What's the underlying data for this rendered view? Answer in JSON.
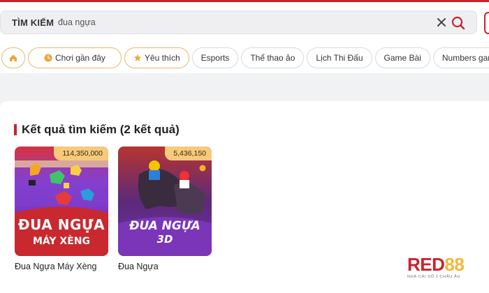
{
  "search": {
    "label": "TÌM KIẾM",
    "value": "đua ngựa"
  },
  "tabs": [
    {
      "label": "",
      "icon": "home-icon"
    },
    {
      "label": "Chơi gần đây",
      "icon": "clock-icon"
    },
    {
      "label": "Yêu thích",
      "icon": "star-icon"
    },
    {
      "label": "Esports"
    },
    {
      "label": "Thể thao ảo"
    },
    {
      "label": "Lịch Thi Đấu"
    },
    {
      "label": "Game Bài"
    },
    {
      "label": "Numbers game"
    }
  ],
  "results": {
    "title": "Kết quả tìm kiếm (2 kết quả)",
    "items": [
      {
        "name": "Đua Ngựa Máy Xèng",
        "count": "114,350,000",
        "art_line1": "ĐUA NGỰA",
        "art_line2": "MÁY XÈNG"
      },
      {
        "name": "Đua Ngựa",
        "count": "5,436,150",
        "art_line1": "ĐUA NGỰA",
        "art_line2": "3D"
      }
    ]
  },
  "brand": {
    "name_part1": "RED",
    "name_part2": "88",
    "tagline": "NHÀ CÁI SỐ 1 CHÂU ÂU"
  },
  "colors": {
    "accent": "#c8232c",
    "gold": "#f7c97b"
  }
}
